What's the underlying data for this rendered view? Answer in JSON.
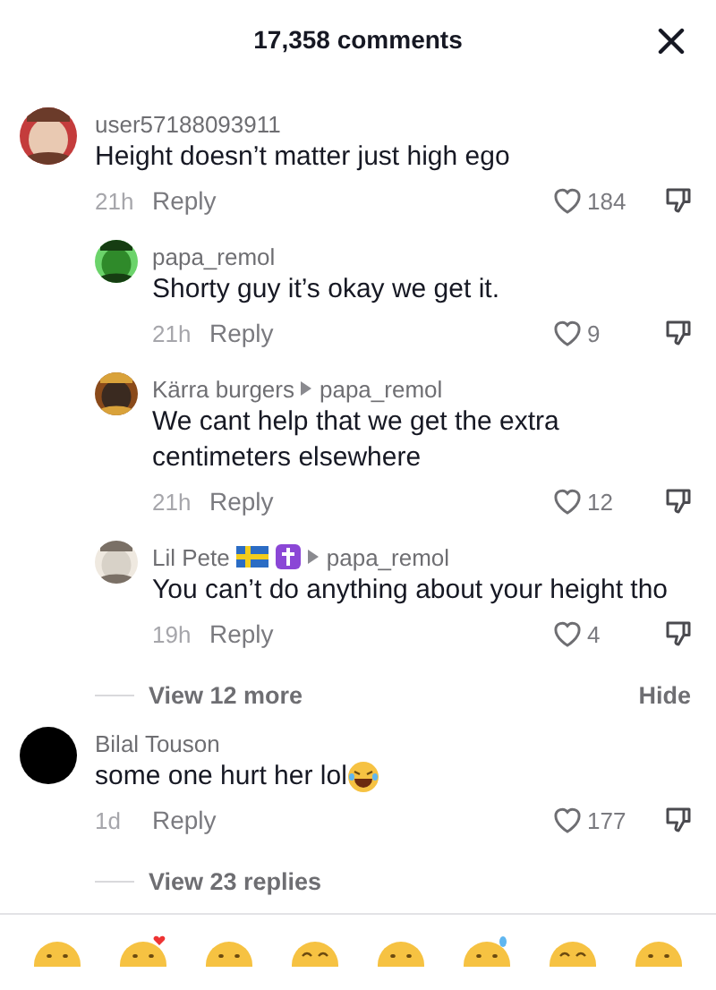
{
  "header": {
    "title": "17,358 comments"
  },
  "comments": [
    {
      "avatar": {
        "kind": "picture"
      },
      "user": "user57188093911",
      "text": "Height doesn’t matter just high ego",
      "time": "21h",
      "reply_label": "Reply",
      "likes": "184",
      "replies": [
        {
          "avatar": {
            "kind": "picture"
          },
          "user": "papa_remol",
          "text": "Shorty guy it’s okay we get it.",
          "time": "21h",
          "reply_label": "Reply",
          "likes": "9"
        },
        {
          "avatar": {
            "kind": "picture"
          },
          "user": "Kärra burgers",
          "reply_to": "papa_remol",
          "text": "We cant help that we get the extra centimeters elsewhere",
          "time": "21h",
          "reply_label": "Reply",
          "likes": "12"
        },
        {
          "avatar": {
            "kind": "picture"
          },
          "user": "Lil Pete",
          "badges": [
            {
              "kind": "flag"
            },
            {
              "kind": "cross"
            }
          ],
          "reply_to": "papa_remol",
          "text": "You can’t do anything about your height tho",
          "time": "19h",
          "reply_label": "Reply",
          "likes": "4"
        }
      ],
      "view_more": "View 12 more",
      "hide": "Hide"
    },
    {
      "avatar": {
        "kind": "blank"
      },
      "user": "Bilal Touson",
      "text": "some one hurt her lol",
      "trailing_emoji": {
        "kind": "laughing"
      },
      "time": "1d",
      "reply_label": "Reply",
      "likes": "177",
      "view_more": "View 23 replies"
    }
  ],
  "emoji_bar": [
    {
      "kind": "smile"
    },
    {
      "kind": "heart"
    },
    {
      "kind": "smile"
    },
    {
      "kind": "happy"
    },
    {
      "kind": "smile"
    },
    {
      "kind": "sweat"
    },
    {
      "kind": "happy"
    },
    {
      "kind": "smile"
    }
  ]
}
